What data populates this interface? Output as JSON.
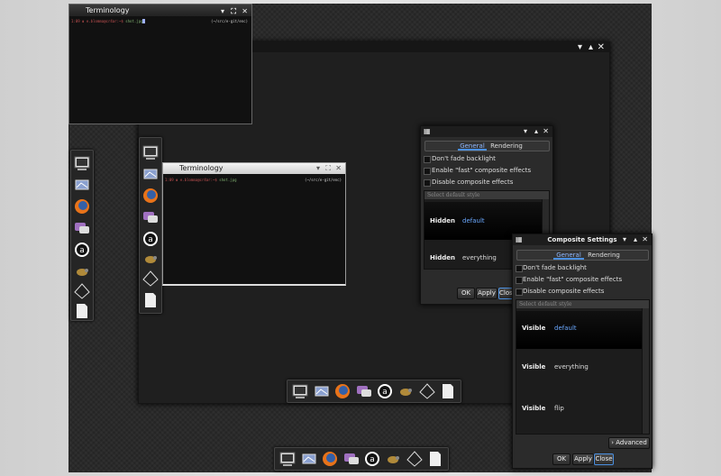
{
  "terminal_main": {
    "title": "Terminology",
    "prompt_user": "1:09 ▮ e.blomma@cr4ar:~$ ",
    "prompt_cmd": "shot.jpg",
    "prompt_right": "(~/src/e-git/enc)"
  },
  "terminal_float": {
    "title": "Terminology",
    "prompt_user": "1:09 ▮ e.blomma@cr4ar:~$ ",
    "prompt_cmd": "shot.jpg",
    "prompt_right": "(~/src/e-git/enc)"
  },
  "composite_back": {
    "title": "",
    "tabs": [
      "General",
      "Rendering"
    ],
    "options": [
      "Don't fade backlight",
      "Enable \"fast\" composite effects",
      "Disable composite effects"
    ],
    "list_header": "Select default style",
    "rows": [
      {
        "key": "Hidden",
        "value": "default",
        "selected": true
      },
      {
        "key": "Hidden",
        "value": "everything",
        "selected": false
      }
    ],
    "buttons": [
      "OK",
      "Apply",
      "Close"
    ]
  },
  "composite_front": {
    "title": "Composite Settings",
    "tabs": [
      "General",
      "Rendering"
    ],
    "options": [
      "Don't fade backlight",
      "Enable \"fast\" composite effects",
      "Disable composite effects"
    ],
    "list_header": "Select default style",
    "rows": [
      {
        "key": "Visible",
        "value": "default",
        "selected": true
      },
      {
        "key": "Visible",
        "value": "everything",
        "selected": false
      },
      {
        "key": "Visible",
        "value": "flip",
        "selected": false
      }
    ],
    "advanced": "Advanced",
    "buttons": [
      "OK",
      "Apply",
      "Close"
    ]
  },
  "window_controls": {
    "minimize": "▾",
    "maximize": "▴",
    "close": "✕"
  },
  "colors": {
    "accent": "#4a8fe0",
    "selected_text": "#6aa8ff",
    "desktop": "#2a2a2a"
  },
  "launcher_icons": [
    "terminal-icon",
    "photo-viewer-icon",
    "firefox-icon",
    "chat-icon",
    "a-app-icon",
    "mouse-icon",
    "inkscape-icon",
    "document-icon"
  ]
}
